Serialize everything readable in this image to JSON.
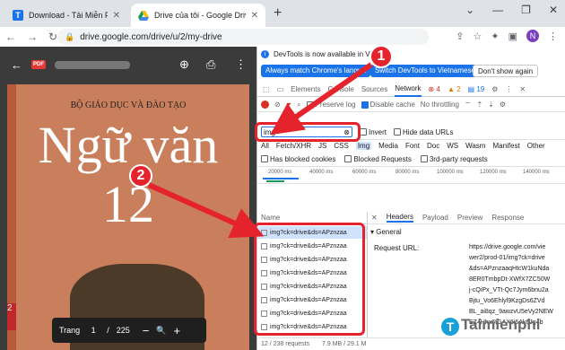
{
  "tabs": [
    {
      "title": "Download - Tải Miễn Phí VN - Ph"
    },
    {
      "title": "Drive của tôi - Google Drive"
    }
  ],
  "address": {
    "url": "drive.google.com/drive/u/2/my-drive"
  },
  "profile": {
    "initial": "N"
  },
  "viewer": {
    "cover_publisher": "BỘ GIÁO DỤC VÀ ĐÀO TẠO",
    "cover_title": "Ngữ văn",
    "cover_number": "12",
    "cover_side_number": "2",
    "page_label": "Trang",
    "page_current": "1",
    "page_sep": "/",
    "page_total": "225",
    "minus": "−",
    "plus": "+"
  },
  "devtools": {
    "info_text": "DevTools is now available in Vie",
    "btn_match": "Always match Chrome's langua",
    "btn_switch": "Switch DevTools to Vietnamese",
    "btn_dont": "Don't show again",
    "tabs": [
      "Elements",
      "Console",
      "Sources",
      "Network"
    ],
    "error_count": "4",
    "warn_count": "2",
    "msg_count": "19",
    "preserve_log": "Preserve log",
    "disable_cache": "Disable cache",
    "throttling": "No throttling",
    "filter_value": "img",
    "invert": "Invert",
    "hide_data_urls": "Hide data URLs",
    "types": [
      "All",
      "Fetch/XHR",
      "JS",
      "CSS",
      "Img",
      "Media",
      "Font",
      "Doc",
      "WS",
      "Wasm",
      "Manifest",
      "Other"
    ],
    "has_blocked_cookies": "Has blocked cookies",
    "blocked_requests": "Blocked Requests",
    "third_party": "3rd-party requests",
    "timeline": [
      "20000 ms",
      "40000 ms",
      "60000 ms",
      "80000 ms",
      "100000 ms",
      "120000 ms",
      "140000 ms"
    ],
    "name_header": "Name",
    "requests": [
      "img?ck=drive&ds=APznzaa",
      "img?ck=drive&ds=APznzaa",
      "img?ck=drive&ds=APznzaa",
      "img?ck=drive&ds=APznzaa",
      "img?ck=drive&ds=APznzaa",
      "img?ck=drive&ds=APznzaa",
      "img?ck=drive&ds=APznzaa",
      "img?ck=drive&ds=APznzaa"
    ],
    "status": "12 / 238 requests",
    "status2": "7.9 MB / 29.1 M",
    "detail_tabs": [
      "Headers",
      "Payload",
      "Preview",
      "Response"
    ],
    "general": "General",
    "request_url_label": "Request URL:",
    "request_url_lines": [
      "https://drive.google.com/vie",
      "wer2/prod-01/img?ck=drive",
      "&ds=APznzaaqHtcW1kuNda",
      "8ER0TmbpDt-XWfX7ZC50W",
      "j-cQiPx_VTt-Qc7Jym6bnu2a",
      "Bjtu_Vo6Ehlyl9KzgDs6ZVd",
      "BL_ai8qz_9awzvU5eVy2NEW",
      "EZ4Hhx6tGAX6i6Ak6Jg4b"
    ]
  },
  "annotations": {
    "badge1": "1",
    "badge2": "2",
    "logo": "Taimienphi",
    "logo_mark": "T"
  }
}
